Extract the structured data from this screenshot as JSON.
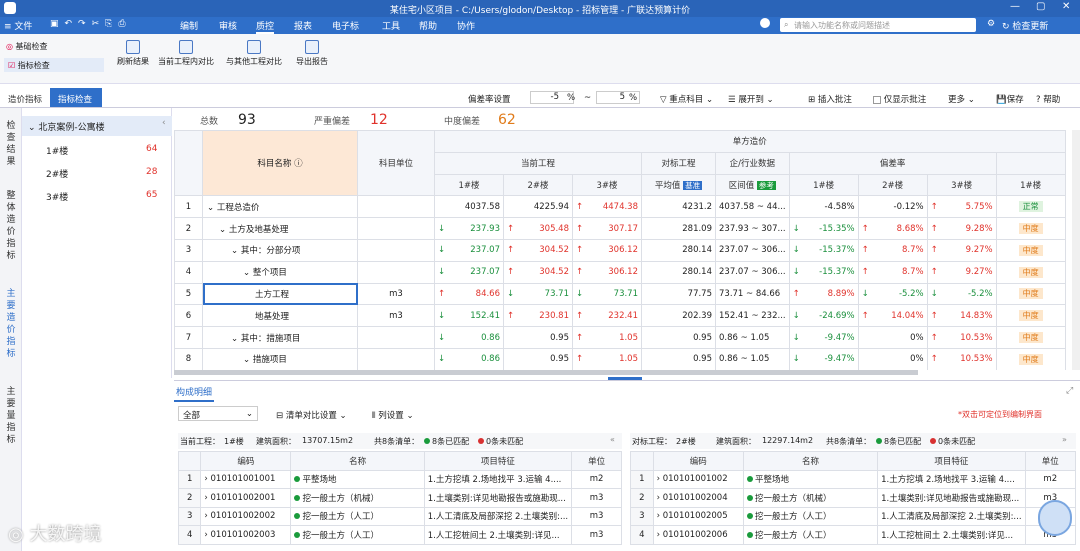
{
  "window": {
    "title": "某住宅小区项目 - C:/Users/glodon/Desktop - 招标管理 - 广联达预算计价"
  },
  "menu": {
    "file": "文件",
    "items": [
      "编制",
      "审核",
      "质控",
      "报表",
      "电子标",
      "工具",
      "帮助",
      "协作"
    ],
    "search_placeholder": "请输入功能名称或问题描述",
    "update": "检查更新"
  },
  "ribbon": {
    "left_items": [
      "基础检查",
      "指标检查"
    ],
    "buttons": [
      "刷新结果",
      "当前工程内对比",
      "与其他工程对比",
      "导出报告"
    ]
  },
  "tabs": [
    "造价指标",
    "指标检查"
  ],
  "toolbar": {
    "dev_label": "偏差率设置",
    "dev_low": "-5",
    "dev_high": "5",
    "pct": "%",
    "tilde": "~",
    "focus": "重点科目",
    "expand": "展开到",
    "insert_note": "插入批注",
    "only_note": "仅显示批注",
    "more": "更多",
    "save": "保存",
    "help": "帮助"
  },
  "summary": {
    "total_label": "总数",
    "total": "93",
    "severe_label": "严重偏差",
    "severe": "12",
    "mid_label": "中度偏差",
    "mid": "62"
  },
  "vtabs": [
    "检查结果",
    "整体造价指标",
    "主要造价指标",
    "主要量指标"
  ],
  "tree": {
    "root": "北京案例-公寓楼",
    "items": [
      {
        "name": "1#楼",
        "count": "64"
      },
      {
        "name": "2#楼",
        "count": "28"
      },
      {
        "name": "3#楼",
        "count": "65"
      }
    ]
  },
  "grid": {
    "headers": {
      "name": "科目名称",
      "unit": "科目单位",
      "unit_price": "单方造价",
      "current": "当前工程",
      "compare": "对标工程",
      "industry": "企/行业数据",
      "deviation": "偏差率",
      "b1": "1#楼",
      "b2": "2#楼",
      "b3": "3#楼",
      "avg": "平均值",
      "base": "基准",
      "range": "区间值",
      "ref": "参考"
    },
    "rows": [
      {
        "n": "1",
        "name": "工程总造价",
        "unit": "",
        "c1": "4037.58",
        "c2": "4225.94",
        "c3": "4474.38",
        "c3d": "up",
        "avg": "4231.2",
        "range": "4037.58 ~ 44...",
        "d1": "-4.58%",
        "d1d": "",
        "d2": "-0.12%",
        "d2d": "",
        "d3": "5.75%",
        "d3d": "up",
        "lvl": "正常",
        "lv": "ok",
        "indent": 0
      },
      {
        "n": "2",
        "name": "土方及地基处理",
        "unit": "",
        "c1": "237.93",
        "c1d": "dn",
        "c2": "305.48",
        "c2d": "up",
        "c3": "307.17",
        "c3d": "up",
        "avg": "281.09",
        "range": "237.93 ~ 307...",
        "d1": "-15.35%",
        "d1d": "dn",
        "d2": "8.68%",
        "d2d": "up",
        "d3": "9.28%",
        "d3d": "up",
        "lvl": "中度",
        "lv": "mid",
        "indent": 1
      },
      {
        "n": "3",
        "name": "其中：分部分项",
        "unit": "",
        "c1": "237.07",
        "c1d": "dn",
        "c2": "304.52",
        "c2d": "up",
        "c3": "306.12",
        "c3d": "up",
        "avg": "280.14",
        "range": "237.07 ~ 306...",
        "d1": "-15.37%",
        "d1d": "dn",
        "d2": "8.7%",
        "d2d": "up",
        "d3": "9.27%",
        "d3d": "up",
        "lvl": "中度",
        "lv": "mid",
        "indent": 2
      },
      {
        "n": "4",
        "name": "整个项目",
        "unit": "",
        "c1": "237.07",
        "c1d": "dn",
        "c2": "304.52",
        "c2d": "up",
        "c3": "306.12",
        "c3d": "up",
        "avg": "280.14",
        "range": "237.07 ~ 306...",
        "d1": "-15.37%",
        "d1d": "dn",
        "d2": "8.7%",
        "d2d": "up",
        "d3": "9.27%",
        "d3d": "up",
        "lvl": "中度",
        "lv": "mid",
        "indent": 3
      },
      {
        "n": "5",
        "name": "土方工程",
        "unit": "m3",
        "c1": "84.66",
        "c1d": "up",
        "c2": "73.71",
        "c2d": "dn",
        "c3": "73.71",
        "c3d": "dn",
        "avg": "77.75",
        "range": "73.71 ~ 84.66",
        "d1": "8.89%",
        "d1d": "up",
        "d2": "-5.2%",
        "d2d": "dn",
        "d3": "-5.2%",
        "d3d": "dn",
        "lvl": "中度",
        "lv": "mid",
        "indent": 4
      },
      {
        "n": "6",
        "name": "地基处理",
        "unit": "m3",
        "c1": "152.41",
        "c1d": "dn",
        "c2": "230.81",
        "c2d": "up",
        "c3": "232.41",
        "c3d": "up",
        "avg": "202.39",
        "range": "152.41 ~ 232...",
        "d1": "-24.69%",
        "d1d": "dn",
        "d2": "14.04%",
        "d2d": "up",
        "d3": "14.83%",
        "d3d": "up",
        "lvl": "中度",
        "lv": "mid",
        "indent": 4
      },
      {
        "n": "7",
        "name": "其中：措施项目",
        "unit": "",
        "c1": "0.86",
        "c1d": "dn",
        "c2": "0.95",
        "c3": "1.05",
        "c3d": "up",
        "avg": "0.95",
        "range": "0.86 ~ 1.05",
        "d1": "-9.47%",
        "d1d": "dn",
        "d2": "0%",
        "d3": "10.53%",
        "d3d": "up",
        "lvl": "中度",
        "lv": "mid",
        "indent": 2
      },
      {
        "n": "8",
        "name": "措施项目",
        "unit": "",
        "c1": "0.86",
        "c1d": "dn",
        "c2": "0.95",
        "c3": "1.05",
        "c3d": "up",
        "avg": "0.95",
        "range": "0.86 ~ 1.05",
        "d1": "-9.47%",
        "d1d": "dn",
        "d2": "0%",
        "d3": "10.53%",
        "d3d": "up",
        "lvl": "中度",
        "lv": "mid",
        "indent": 3
      }
    ]
  },
  "detail": {
    "tab": "构成明细",
    "filter": "全部",
    "compare_settings": "清单对比设置",
    "col_settings": "列设置",
    "hint": "*双击可定位到编制界面",
    "left": {
      "label": "当前工程：",
      "building": "1#楼",
      "area_label": "建筑面积：",
      "area": "13707.15m2",
      "count": "共8条清单：",
      "matched": "8条已匹配",
      "unmatched": "0条未匹配"
    },
    "right": {
      "label": "对标工程：",
      "building": "2#楼",
      "area_label": "建筑面积：",
      "area": "12297.14m2",
      "count": "共8条清单：",
      "matched": "8条已匹配",
      "unmatched": "0条未匹配"
    },
    "headers": [
      "编码",
      "名称",
      "项目特征",
      "单位"
    ],
    "left_rows": [
      [
        "1",
        "010101001001",
        "平整场地",
        "1.土方挖填 2.场地找平 3.运输 4....",
        "m2"
      ],
      [
        "2",
        "010101002001",
        "挖一般土方（机械）",
        "1.土壤类别:详见地勘报告或施勘现...",
        "m3"
      ],
      [
        "3",
        "010101002002",
        "挖一般土方（人工）",
        "1.人工清底及局部深挖 2.土壤类别:...",
        "m3"
      ],
      [
        "4",
        "010101002003",
        "挖一般土方（人工）",
        "1.人工挖桩间土 2.土壤类别:详见...",
        "m3"
      ]
    ],
    "right_rows": [
      [
        "1",
        "010101001002",
        "平整场地",
        "1.土方挖填 2.场地找平 3.运输 4....",
        "m2"
      ],
      [
        "2",
        "010101002004",
        "挖一般土方（机械）",
        "1.土壤类别:详见地勘报告或施勘现...",
        "m3"
      ],
      [
        "3",
        "010101002005",
        "挖一般土方（人工）",
        "1.人工清底及局部深挖 2.土壤类别:...",
        "m3"
      ],
      [
        "4",
        "010101002006",
        "挖一般土方（人工）",
        "1.人工挖桩间土 2.土壤类别:详见...",
        "m3"
      ]
    ]
  },
  "watermark": "大数跨境"
}
